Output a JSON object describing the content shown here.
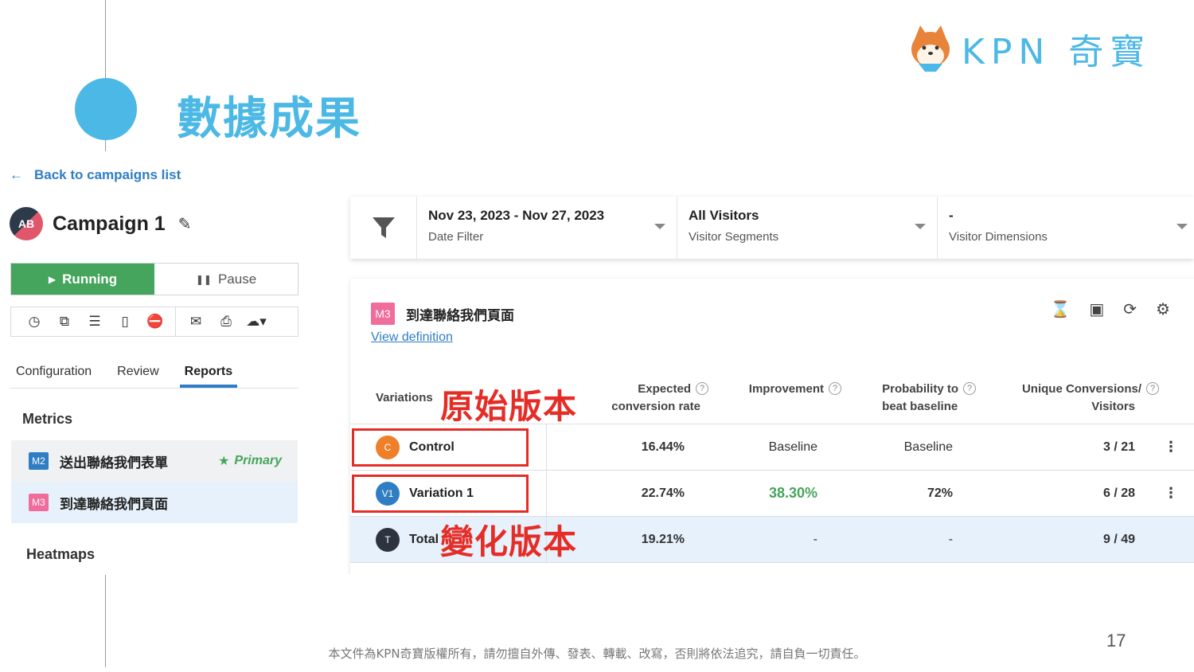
{
  "slide": {
    "title": "數據成果",
    "logo_text": "KPN 奇寶",
    "page_number": "17",
    "footer": "本文件為KPN奇寶版權所有，請勿擅自外傳、發表、轉載、改寫，否則將依法追究，請自負一切責任。"
  },
  "colors": {
    "accent": "#4bb8e6",
    "running": "#45a55c",
    "link": "#2f7ec4",
    "annotation": "#e52d27",
    "improvement": "#45a55c"
  },
  "nav": {
    "back_label": "Back to campaigns list"
  },
  "campaign": {
    "icon_text": "AB",
    "name": "Campaign 1"
  },
  "status": {
    "running_label": "Running",
    "pause_label": "Pause"
  },
  "toolbar_icons": [
    "history-icon",
    "duplicate-icon",
    "database-icon",
    "inbox-icon",
    "stop-icon",
    "mail-icon",
    "print-icon",
    "cloud-download-icon"
  ],
  "tabs": [
    {
      "label": "Configuration",
      "active": false
    },
    {
      "label": "Review",
      "active": false
    },
    {
      "label": "Reports",
      "active": true
    }
  ],
  "sidebar": {
    "metrics_heading": "Metrics",
    "metrics": [
      {
        "badge": "M2",
        "badge_color": "#2f7ec4",
        "label": "送出聯絡我們表單",
        "tag": "Primary"
      },
      {
        "badge": "M3",
        "badge_color": "#f06c9b",
        "label": "到達聯絡我們頁面",
        "tag": ""
      }
    ],
    "heatmaps_heading": "Heatmaps"
  },
  "filters": [
    {
      "value": "Nov 23, 2023 - Nov 27, 2023",
      "label": "Date Filter"
    },
    {
      "value": "All Visitors",
      "label": "Visitor Segments"
    },
    {
      "value": "-",
      "label": "Visitor Dimensions"
    }
  ],
  "report": {
    "badge": "M3",
    "title": "到達聯絡我們頁面",
    "view_definition": "View definition",
    "columns": {
      "variations": "Variations",
      "expected_1": "Expected",
      "expected_2": "conversion rate",
      "improvement": "Improvement",
      "probability_1": "Probability to",
      "probability_2": "beat baseline",
      "unique_1": "Unique Conversions/",
      "unique_2": "Visitors"
    },
    "rows": [
      {
        "badge": "C",
        "badge_color": "#f07f2a",
        "name": "Control",
        "expected": "16.44%",
        "improvement": "Baseline",
        "probability": "Baseline",
        "conversions": "3 / 21"
      },
      {
        "badge": "V1",
        "badge_color": "#2f7ec4",
        "name": "Variation 1",
        "expected": "22.74%",
        "improvement": "38.30%",
        "probability": "72%",
        "conversions": "6 / 28"
      },
      {
        "badge": "T",
        "badge_color": "#2d3440",
        "name": "Total",
        "expected": "19.21%",
        "improvement": "-",
        "probability": "-",
        "conversions": "9 / 49"
      }
    ]
  },
  "annotations": {
    "original": "原始版本",
    "variation": "變化版本"
  }
}
